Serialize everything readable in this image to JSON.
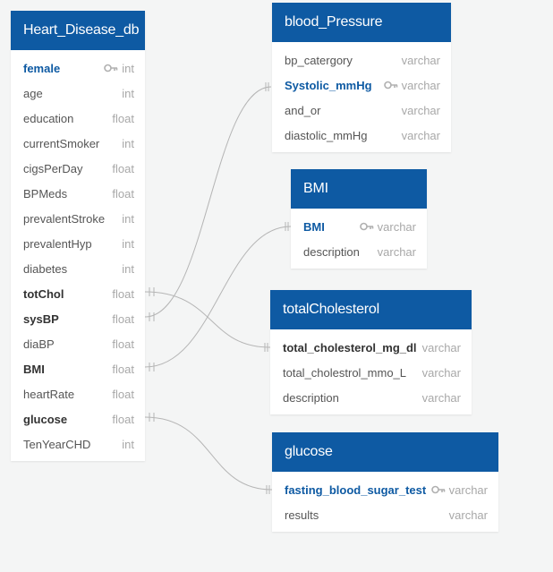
{
  "tables": [
    {
      "id": "heart",
      "title": "Heart_Disease_db",
      "fields": [
        {
          "name": "female",
          "type": "int",
          "style": "pk",
          "key": true
        },
        {
          "name": "age",
          "type": "int"
        },
        {
          "name": "education",
          "type": "float"
        },
        {
          "name": "currentSmoker",
          "type": "int"
        },
        {
          "name": "cigsPerDay",
          "type": "float"
        },
        {
          "name": "BPMeds",
          "type": "float"
        },
        {
          "name": "prevalentStroke",
          "type": "int"
        },
        {
          "name": "prevalentHyp",
          "type": "int"
        },
        {
          "name": "diabetes",
          "type": "int"
        },
        {
          "name": "totChol",
          "type": "float",
          "style": "bold"
        },
        {
          "name": "sysBP",
          "type": "float",
          "style": "bold"
        },
        {
          "name": "diaBP",
          "type": "float"
        },
        {
          "name": "BMI",
          "type": "float",
          "style": "bold"
        },
        {
          "name": "heartRate",
          "type": "float"
        },
        {
          "name": "glucose",
          "type": "float",
          "style": "bold"
        },
        {
          "name": "TenYearCHD",
          "type": "int"
        }
      ]
    },
    {
      "id": "bp",
      "title": "blood_Pressure",
      "fields": [
        {
          "name": "bp_catergory",
          "type": "varchar"
        },
        {
          "name": "Systolic_mmHg",
          "type": "varchar",
          "style": "pk",
          "key": true
        },
        {
          "name": "and_or",
          "type": "varchar"
        },
        {
          "name": "diastolic_mmHg",
          "type": "varchar"
        }
      ]
    },
    {
      "id": "bmi",
      "title": "BMI",
      "fields": [
        {
          "name": "BMI",
          "type": "varchar",
          "style": "pk",
          "key": true
        },
        {
          "name": "description",
          "type": "varchar"
        }
      ]
    },
    {
      "id": "chol",
      "title": "totalCholesterol",
      "fields": [
        {
          "name": "total_cholesterol_mg_dl",
          "type": "varchar",
          "style": "bold"
        },
        {
          "name": "total_cholestrol_mmo_L",
          "type": "varchar"
        },
        {
          "name": "description",
          "type": "varchar"
        }
      ]
    },
    {
      "id": "glu",
      "title": "glucose",
      "fields": [
        {
          "name": "fasting_blood_sugar_test",
          "type": "varchar",
          "style": "pk",
          "key": true
        },
        {
          "name": "results",
          "type": "varchar"
        }
      ]
    }
  ],
  "colors": {
    "header": "#0e5aa3",
    "key": "#0e5aa3",
    "link": "#b5b5b5"
  }
}
